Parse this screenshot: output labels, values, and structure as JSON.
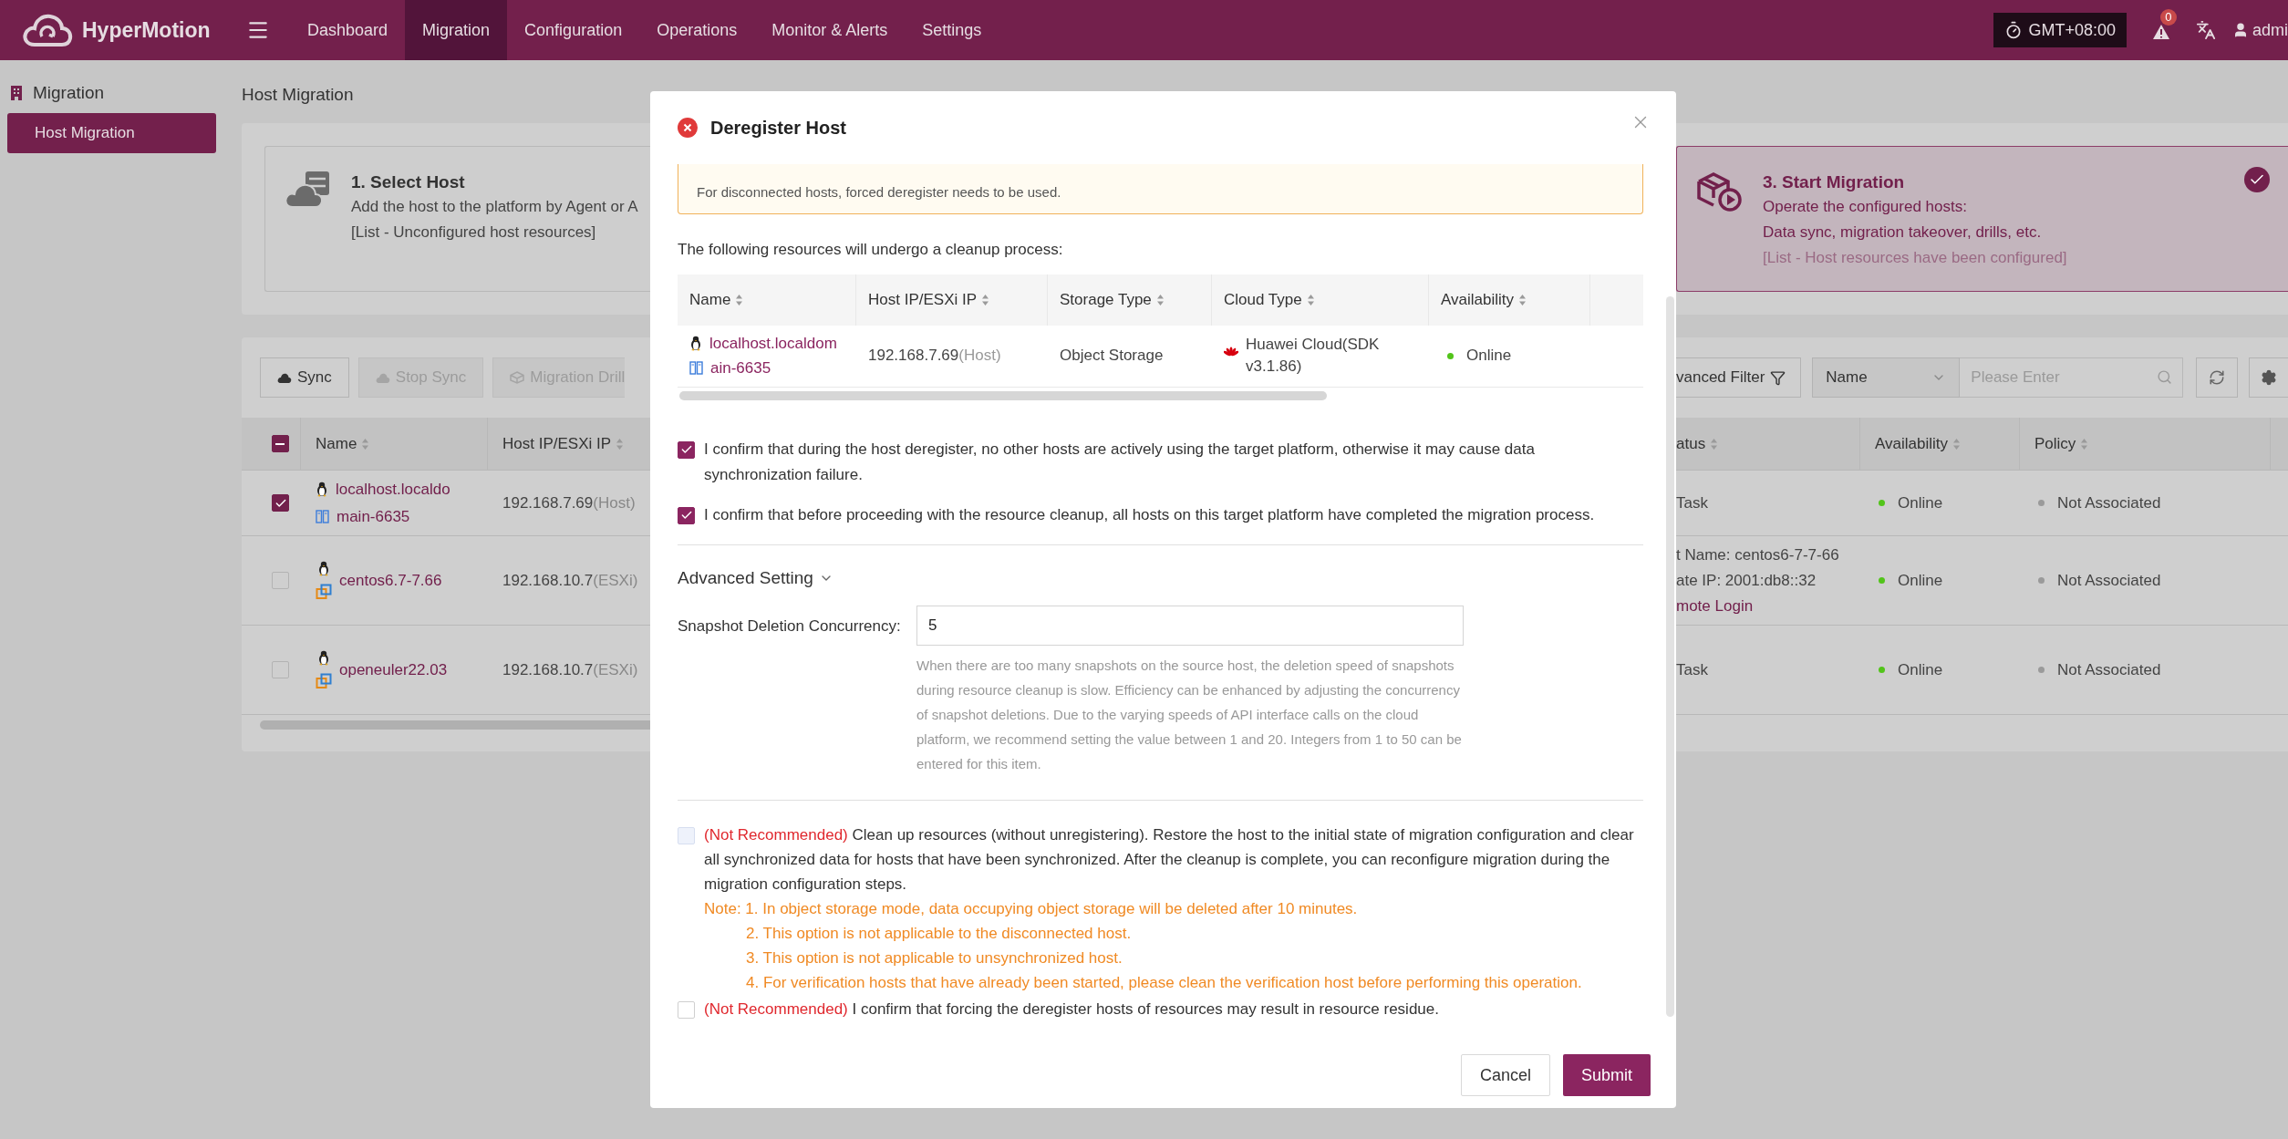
{
  "nav": {
    "brand": "HyperMotion",
    "menu": [
      {
        "label": "Dashboard",
        "selected": false
      },
      {
        "label": "Migration",
        "selected": true
      },
      {
        "label": "Configuration",
        "selected": false
      },
      {
        "label": "Operations",
        "selected": false
      },
      {
        "label": "Monitor & Alerts",
        "selected": false
      },
      {
        "label": "Settings",
        "selected": false
      }
    ],
    "timezone": "GMT+08:00",
    "alert_count": "0",
    "user": "admi"
  },
  "sidebar": {
    "section": "Migration",
    "items": [
      {
        "label": "Host Migration",
        "selected": true
      }
    ]
  },
  "page_title": "Host Migration",
  "steps": [
    {
      "title": "1. Select Host",
      "lines": [
        "Add the host to the platform by Agent or A"
      ],
      "link": "[List - Unconfigured host resources]",
      "selected": false
    },
    {
      "title": "3. Start Migration",
      "lines": [
        "Operate the configured hosts:",
        "Data sync, migration takeover, drills, etc."
      ],
      "link": "[List - Host resources have been configured]",
      "selected": true
    }
  ],
  "toolbar": {
    "buttons": [
      {
        "label": "Sync",
        "disabled": false,
        "kind": "sync"
      },
      {
        "label": "Stop Sync",
        "disabled": true,
        "kind": "stop"
      },
      {
        "label": "Migration Drill",
        "disabled": true,
        "kind": "drill"
      }
    ],
    "filter": "vanced Filter",
    "search_field": "Name",
    "search_placeholder": "Please Enter"
  },
  "host_table": {
    "indeterminate": true,
    "columns_left": [
      "Name",
      "Host IP/ESXi IP"
    ],
    "columns_right": [
      "atus",
      "Availability",
      "Policy"
    ],
    "rows": [
      {
        "checked": true,
        "kind": "agent",
        "name_lines": [
          "localhost.localdo",
          "main-6635"
        ],
        "ip": "192.168.7.69",
        "ip_type": "(Host)",
        "status_lines": [
          "Task"
        ],
        "availability": "Online",
        "color": "#52c41a",
        "policy": "Not Associated"
      },
      {
        "checked": false,
        "kind": "vmware",
        "name_lines": [
          "centos6.7-7.66"
        ],
        "ip": "192.168.10.7",
        "ip_type": "(ESXi)",
        "status_lines": [
          "t Name: centos6-7-7-66",
          "ate IP: 2001:db8::32"
        ],
        "status_link": "mote Login",
        "availability": "Online",
        "color": "#52c41a",
        "policy": "Not Associated"
      },
      {
        "checked": false,
        "kind": "vmware",
        "name_lines": [
          "openeuler22.03"
        ],
        "ip": "192.168.10.7",
        "ip_type": "(ESXi)",
        "status_lines": [
          "Task"
        ],
        "availability": "Online",
        "color": "#52c41a",
        "policy": "Not Associated"
      }
    ]
  },
  "dialog": {
    "title": "Deregister Host",
    "notice": "For disconnected hosts, forced deregister needs to be used.",
    "intro": "The following resources will undergo a cleanup process:",
    "columns": [
      "Name",
      "Host IP/ESXi IP",
      "Storage Type",
      "Cloud Type",
      "Availability"
    ],
    "rows": [
      {
        "name_lines": [
          "localhost.localdom",
          "ain-6635"
        ],
        "ip": "192.168.7.69",
        "ip_type": "(Host)",
        "storage": "Object Storage",
        "cloud": "Huawei Cloud(SDK v3.1.86)",
        "availability": "Online",
        "color": "#52c41a"
      }
    ],
    "confirms": [
      {
        "text": "I confirm that during the host deregister, no other hosts are actively using the target platform, otherwise it may cause data synchronization failure.",
        "checked": true
      },
      {
        "text": "I confirm that before proceeding with the resource cleanup, all hosts on this target platform have completed the migration process.",
        "checked": true
      }
    ],
    "advanced": {
      "label": "Advanced Setting",
      "expanded": true
    },
    "concurrency": {
      "label": "Snapshot Deletion Concurrency:",
      "value": "5",
      "help": "When there are too many snapshots on the source host, the deletion speed of snapshots during resource cleanup is slow. Efficiency can be enhanced by adjusting the concurrency of snapshot deletions. Due to the varying speeds of API interface calls on the cloud platform, we recommend setting the value between 1 and 20. Integers from 1 to 50 can be entered for this item."
    },
    "options": [
      {
        "tag": "(Not Recommended)",
        "text": "Clean up resources (without unregistering). Restore the host to the initial state of migration configuration and clear all synchronized data for hosts that have been synchronized. After the cleanup is complete, you can reconfigure migration during the migration configuration steps.",
        "checked": false,
        "disabled": true,
        "notes": [
          "Note: 1. In object storage mode, data occupying object storage will be deleted after 10 minutes.",
          "2. This option is not applicable to the disconnected host.",
          "3. This option is not applicable to unsynchronized host.",
          "4. For verification hosts that have already been started, please clean the verification host before performing this operation."
        ]
      },
      {
        "tag": "(Not Recommended)",
        "text": "I confirm that forcing the deregister hosts of resources may result in resource residue.",
        "checked": false,
        "disabled": false
      }
    ],
    "buttons": [
      {
        "label": "Cancel",
        "kind": "secondary"
      },
      {
        "label": "Submit",
        "kind": "primary"
      }
    ]
  }
}
